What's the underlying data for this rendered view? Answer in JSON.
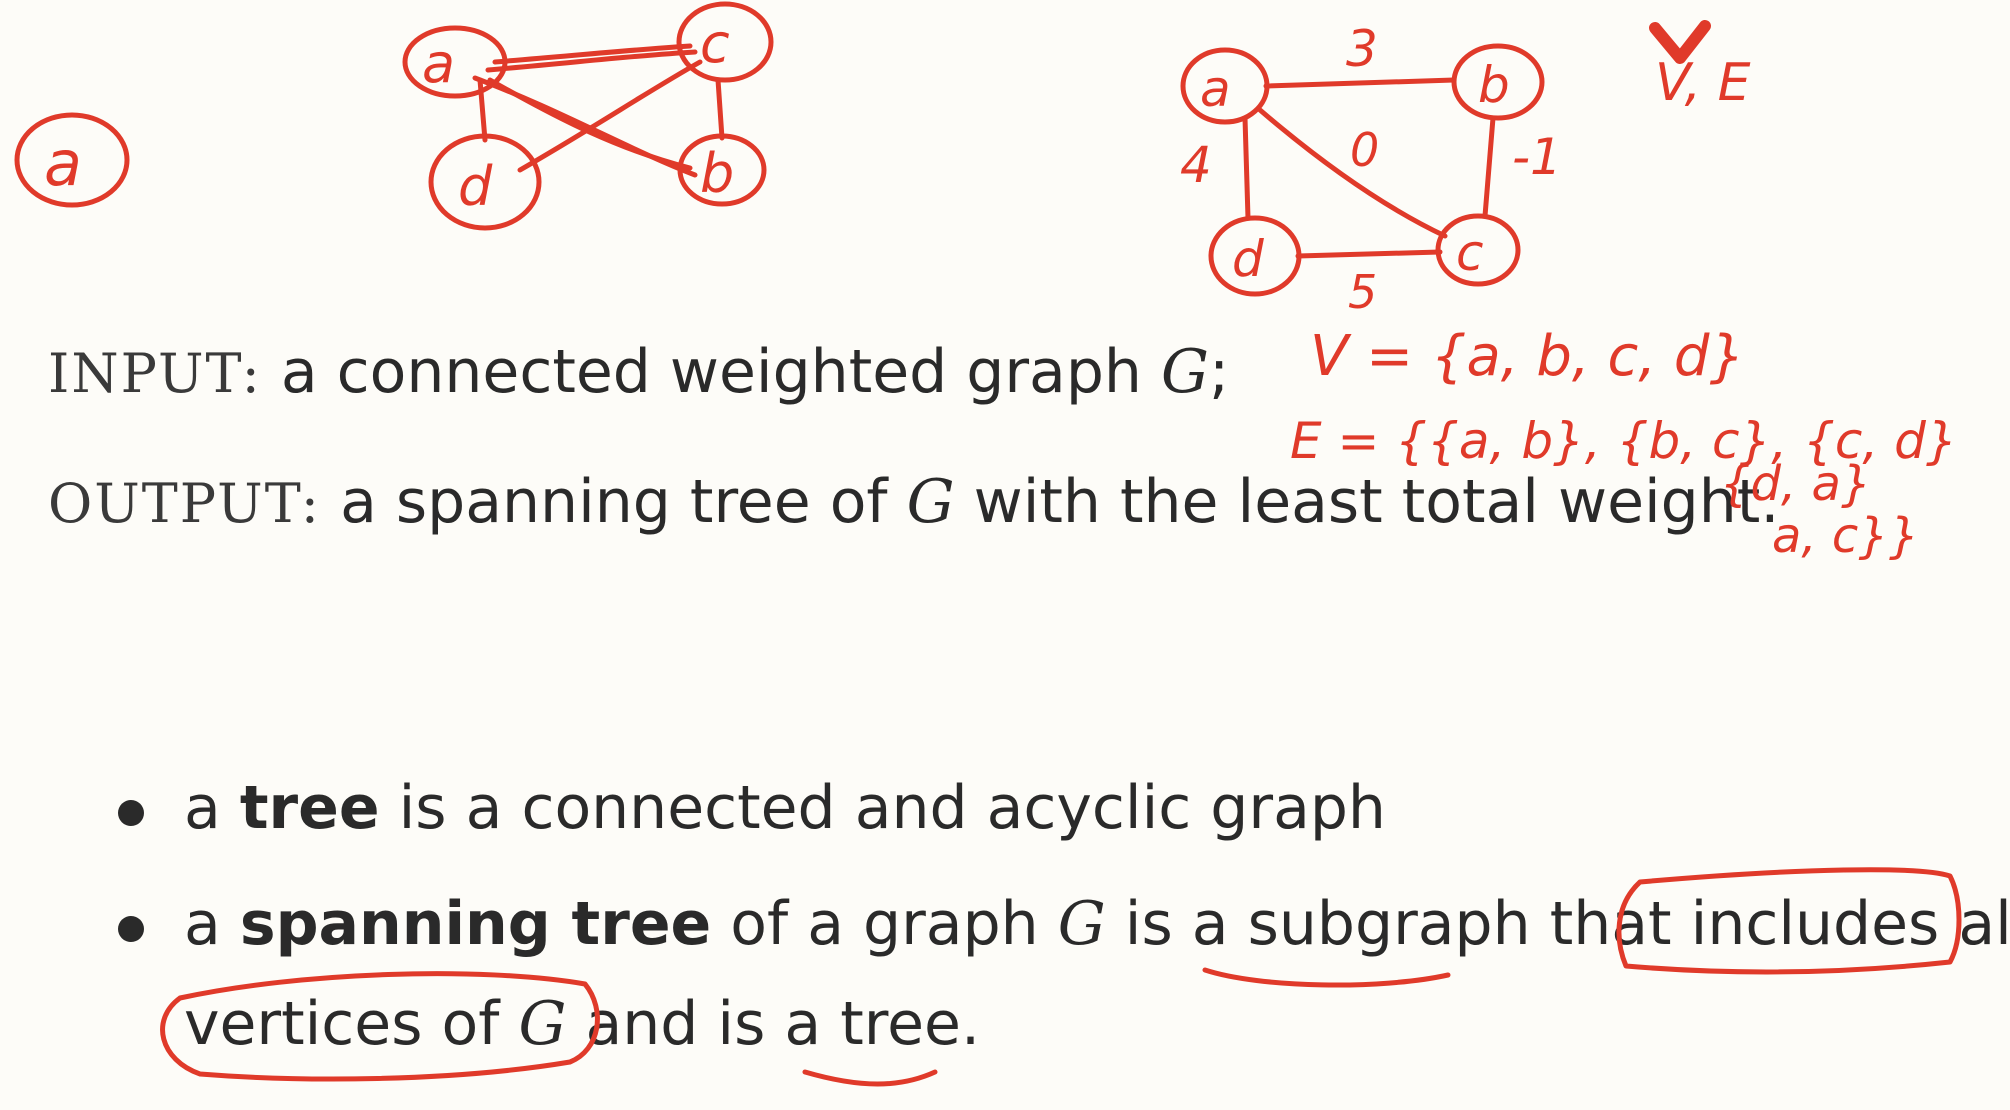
{
  "problem": {
    "input_label": "INPUT:",
    "input_text_pre": "a connected weighted graph",
    "input_var": "G",
    "input_text_post": ";",
    "output_label": "OUTPUT:",
    "output_text_pre": "a spanning tree of",
    "output_var": "G",
    "output_text_post": "with the least total weight."
  },
  "bullets": [
    {
      "pre": "a",
      "bold": "tree",
      "post": "is a connected and acyclic graph"
    },
    {
      "pre": "a",
      "bold": "spanning tree",
      "mid": "of a graph",
      "var": "G",
      "mid2": "is a",
      "underlined": "subgraph",
      "mid3": "that",
      "boxed": "includes all",
      "line2_circled_pre": "vertices of",
      "line2_var": "G",
      "line2_mid": "and is a",
      "line2_underlined": "tree",
      "line2_end": "."
    }
  ],
  "annotations": {
    "lone_vertex": "a",
    "graph1_vertices": [
      "a",
      "c",
      "d",
      "b"
    ],
    "graph2_vertices": [
      "a",
      "b",
      "d",
      "c"
    ],
    "graph2_weights": [
      "3",
      "4",
      "0",
      "-1",
      "5"
    ],
    "ve_label": "V, E",
    "v_set": "V = {a, b, c, d}",
    "e_set_line1": "E = {{a, b}, {b, c}, {c, d}",
    "e_set_line2": "{d, a}",
    "e_set_line3": "a, c}}"
  },
  "colors": {
    "ink": "#e03a2a",
    "text": "#2a2a2a",
    "background": "#fdfcf8"
  }
}
